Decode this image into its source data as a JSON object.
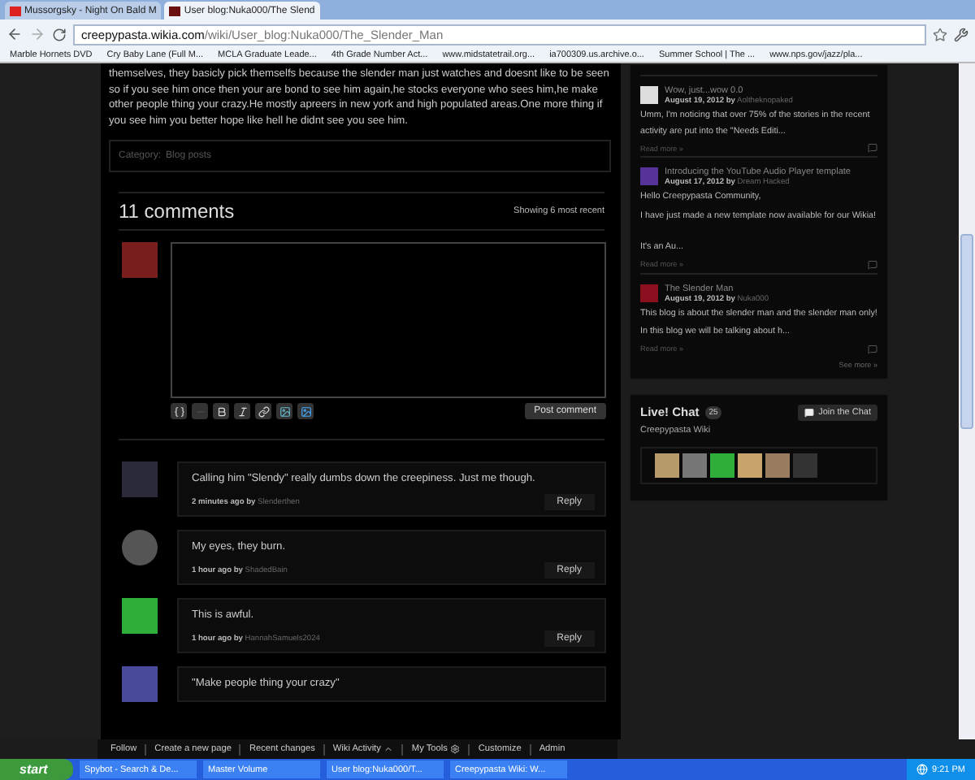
{
  "browser": {
    "tabs": [
      {
        "title": "Mussorgsky - Night On Bald M",
        "selected": false
      },
      {
        "title": "User blog:Nuka000/The Slend",
        "selected": true
      }
    ],
    "url": {
      "host": "creepypasta.wikia.com",
      "path": "/wiki/User_blog:Nuka000/The_Slender_Man"
    },
    "bookmarks": [
      "Marble Hornets DVD",
      "Cry Baby Lane (Full M...",
      "MCLA Graduate Leade...",
      "4th Grade Number Act...",
      "www.midstatetrail.org...",
      "ia700309.us.archive.o...",
      "Summer School | The ...",
      "www.nps.gov/jazz/pla..."
    ]
  },
  "article": {
    "paragraph": "themselves, they basicly pick themselfs because the slender man just watches and doesnt like to be seen so if you see him once then your are bond to see him again,he stocks everyone who sees him,he make other people thing your crazy.He mostly apreers in new york and high populated areas.One more thing if you see him you better hope like hell he didnt see you see him.",
    "category_label": "Category:",
    "category": "Blog posts"
  },
  "comments": {
    "heading": "11 comments",
    "showing": "Showing 6 most recent",
    "post_button": "Post comment",
    "items": [
      {
        "text": "Calling him \"Slendy\" really dumbs down the creepiness. Just me though.",
        "meta": "**2 minutes ago by** Slenderthen",
        "reply": "Reply"
      },
      {
        "text": "My eyes, they burn.",
        "meta": "**1 hour ago by** ShadedBain",
        "reply": "Reply"
      },
      {
        "text": "This is awful.",
        "meta": "**1 hour ago by** HannahSamuels2024",
        "reply": "Reply"
      },
      {
        "text": "\"Make people thing your crazy\""
      }
    ]
  },
  "sidebar": {
    "posts": [
      {
        "title": "Wow, just...wow 0.0",
        "meta": "**August 19, 2012 by** Aoltheknopaked",
        "excerpt": [
          "Umm, I'm noticing that over 75% of the stories in the recent activity are put into the \"Needs Editi..."
        ],
        "read_more": "Read more »"
      },
      {
        "title": "Introducing the YouTube Audio Player template",
        "meta": "**August 17, 2012 by** Dream Hacked",
        "excerpt": [
          "Hello Creepypasta Community,",
          "I have just made a new template now available for our Wikia!"
        ],
        "excerpt_more": [
          "It's an Au..."
        ],
        "read_more": "Read more »"
      },
      {
        "title": "The Slender Man",
        "meta": "**August 19, 2012 by** Nuka000",
        "excerpt": [
          "This blog is about the slender man and the slender man only!",
          "In this blog we will be talking about h..."
        ],
        "read_more": "Read more »"
      }
    ],
    "see_more": "See more »",
    "chat": {
      "title": "Live! Chat",
      "count": "25",
      "wiki": "Creepypasta Wiki",
      "button": "Join the Chat"
    }
  },
  "wiki_toolbar": [
    "Follow",
    "Create a new page",
    "Recent changes",
    "Wiki Activity",
    "My Tools",
    "Customize",
    "Admin"
  ],
  "taskbar": {
    "start": "start",
    "items": [
      "Spybot - Search & De...",
      "Master Volume",
      "User blog:Nuka000/T...",
      "Creepypasta Wiki: W..."
    ],
    "time": "9:21 PM"
  }
}
